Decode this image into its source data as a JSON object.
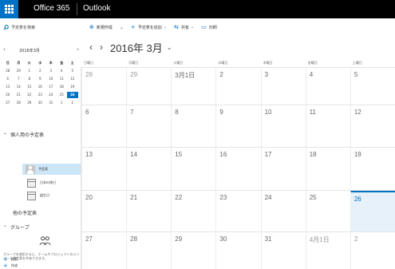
{
  "suite": {
    "app_name": "Office 365",
    "app_title": "Outlook"
  },
  "search": {
    "placeholder": "予定表を検索"
  },
  "toolbar": {
    "new": "新規作成",
    "add_calendar": "予定表を追加",
    "share": "共有",
    "print": "印刷"
  },
  "mini_calendar": {
    "month_label": "2016年3月",
    "weekday_labels": [
      "日",
      "月",
      "火",
      "水",
      "木",
      "金",
      "土"
    ],
    "weeks": [
      [
        "28",
        "29",
        "1",
        "2",
        "3",
        "4",
        "5"
      ],
      [
        "6",
        "7",
        "8",
        "9",
        "10",
        "11",
        "12"
      ],
      [
        "13",
        "14",
        "15",
        "16",
        "17",
        "18",
        "19"
      ],
      [
        "20",
        "21",
        "22",
        "23",
        "24",
        "25",
        "26"
      ],
      [
        "27",
        "28",
        "29",
        "30",
        "31",
        "1",
        "2"
      ]
    ],
    "today": "26"
  },
  "left_nav": {
    "my_calendars_header": "個人用の予定表",
    "calendars": [
      {
        "label": "予定表",
        "selected": true
      },
      {
        "label": "日本の休日",
        "selected": false
      },
      {
        "label": "誕生日",
        "selected": false
      }
    ],
    "other_calendars_header": "他の予定表",
    "groups_header": "グループ",
    "groups_description": "グループを使用すると、チームやプロジェクトのメンバーと予定表を共有できます。",
    "discover_link": "検索",
    "create_link": "作成"
  },
  "main_calendar": {
    "month_label": "2016年 3月",
    "weekday_labels": [
      "日曜日",
      "月曜日",
      "火曜日",
      "水曜日",
      "木曜日",
      "金曜日",
      "土曜日"
    ],
    "weeks": [
      [
        "28",
        "29",
        "3月1日",
        "2",
        "3",
        "4",
        "5"
      ],
      [
        "6",
        "7",
        "8",
        "9",
        "10",
        "11",
        "12"
      ],
      [
        "13",
        "14",
        "15",
        "16",
        "17",
        "18",
        "19"
      ],
      [
        "20",
        "21",
        "22",
        "23",
        "24",
        "25",
        "26"
      ],
      [
        "27",
        "28",
        "29",
        "30",
        "31",
        "4月1日",
        "2"
      ]
    ],
    "today_label": "26",
    "accent_color": "#0072c6"
  }
}
